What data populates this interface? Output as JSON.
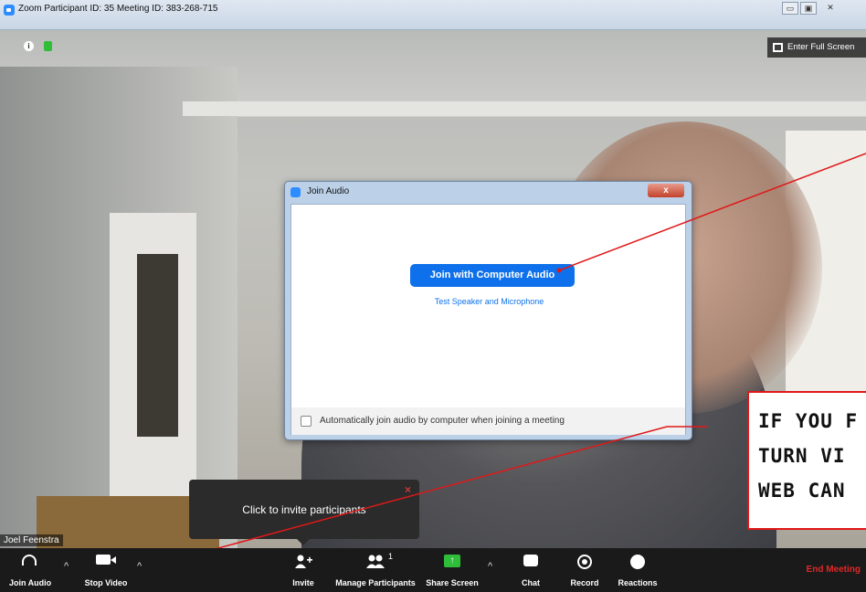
{
  "window": {
    "title": "Zoom Participant ID: 35   Meeting ID: 383-268-715",
    "controls": {
      "minimize": "▭",
      "maximize": "▣",
      "close": "✕"
    }
  },
  "video": {
    "fullscreen_label": "Enter Full Screen",
    "participant_name": "Joel Feenstra",
    "info_icon": "i"
  },
  "dialog": {
    "title": "Join Audio",
    "close_label": "x",
    "join_button": "Join with Computer Audio",
    "test_link": "Test Speaker and Microphone",
    "auto_join_label": "Automatically join audio by computer when joining a meeting"
  },
  "tooltip": {
    "text": "Click to invite participants",
    "close": "×"
  },
  "annotation": {
    "lines": [
      "If you f",
      "turn vi",
      "web can"
    ]
  },
  "toolbar": {
    "join_audio": "Join Audio",
    "stop_video": "Stop Video",
    "invite": "Invite",
    "manage_participants": "Manage Participants",
    "participant_count": "1",
    "share_screen": "Share Screen",
    "chat": "Chat",
    "record": "Record",
    "reactions": "Reactions",
    "end_meeting": "End Meeting",
    "caret": "^"
  },
  "colors": {
    "accent_blue": "#0e71eb",
    "share_green": "#2fbd3a",
    "end_red": "#e02828",
    "annotation_red": "#e01818"
  }
}
